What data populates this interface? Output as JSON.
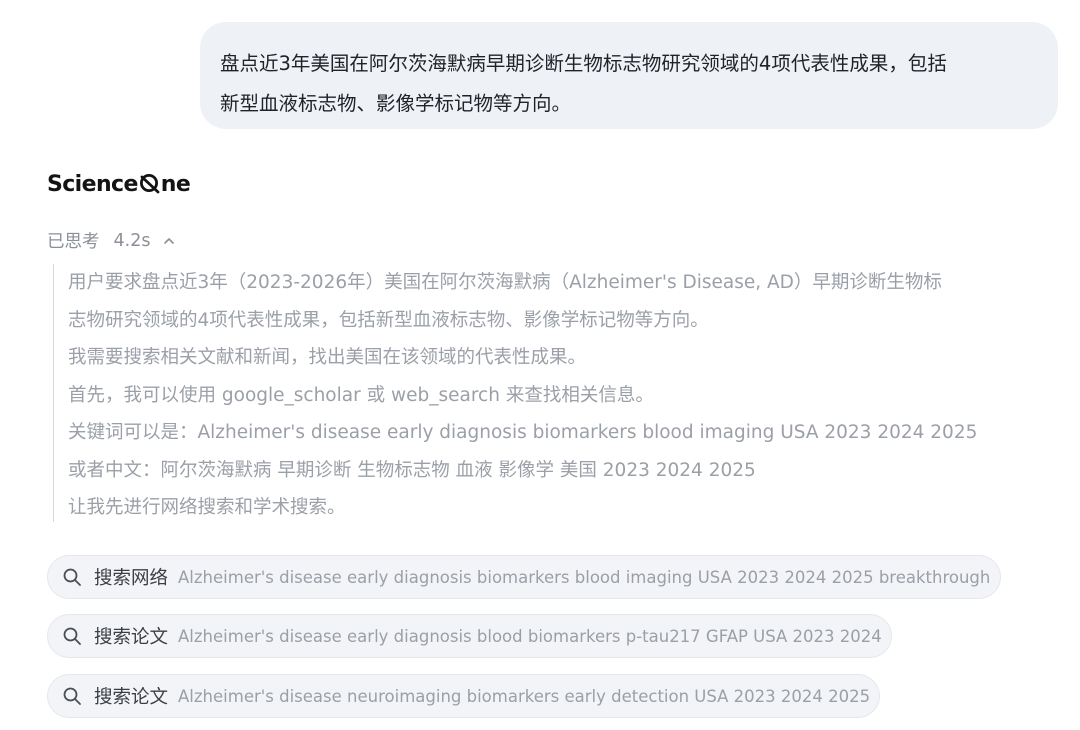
{
  "user_message": {
    "line1": "盘点近3年美国在阿尔茨海默病早期诊断生物标志物研究领域的4项代表性成果，包括",
    "line2": "新型血液标志物、影像学标记物等方向。"
  },
  "brand": {
    "part1": "Science",
    "part2": "ne",
    "logo_icon": "q-shaped-o-icon"
  },
  "thinking": {
    "status": "已思考",
    "duration": "4.2s",
    "toggle_icon": "chevron-up-icon",
    "lines": [
      "用户要求盘点近3年（2023-2026年）美国在阿尔茨海默病（Alzheimer's Disease, AD）早期诊断生物标",
      "志物研究领域的4项代表性成果，包括新型血液标志物、影像学标记物等方向。",
      "我需要搜索相关文献和新闻，找出美国在该领域的代表性成果。",
      "首先，我可以使用 google_scholar 或 web_search 来查找相关信息。",
      "关键词可以是：Alzheimer's disease early diagnosis biomarkers blood imaging USA 2023 2024 2025",
      "或者中文：阿尔茨海默病 早期诊断 生物标志物 血液 影像学 美国 2023 2024 2025",
      "让我先进行网络搜索和学术搜索。"
    ]
  },
  "tool_calls": [
    {
      "icon": "search-icon",
      "label": "搜索网络",
      "query": "Alzheimer's disease early diagnosis biomarkers blood imaging USA 2023 2024 2025 breakthrough"
    },
    {
      "icon": "search-icon",
      "label": "搜索论文",
      "query": "Alzheimer's disease early diagnosis blood biomarkers p-tau217 GFAP USA 2023 2024"
    },
    {
      "icon": "search-icon",
      "label": "搜索论文",
      "query": "Alzheimer's disease neuroimaging biomarkers early detection USA 2023 2024 2025"
    }
  ],
  "colors": {
    "bubble_bg": "#eef1f6",
    "thought_text": "#9ba0a8",
    "pill_bg": "#f3f4f7"
  }
}
